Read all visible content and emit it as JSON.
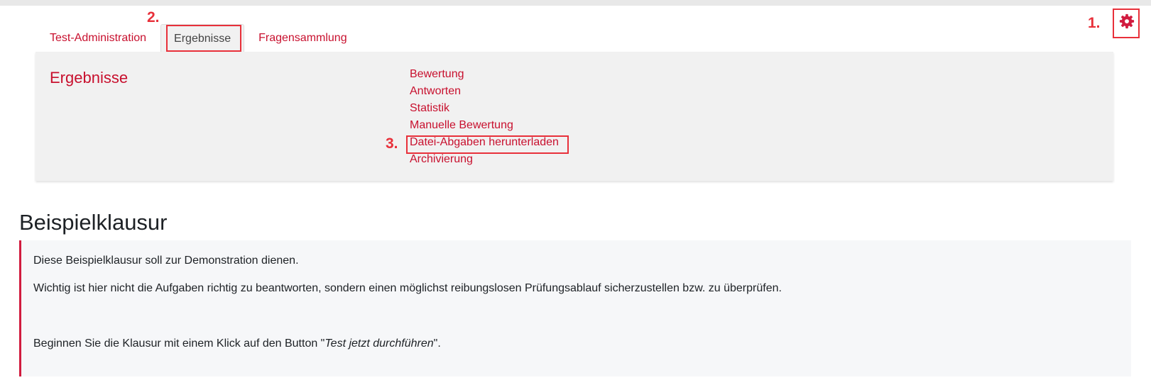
{
  "tabs": [
    {
      "label": "Test-Administration",
      "active": false
    },
    {
      "label": "Ergebnisse",
      "active": true
    },
    {
      "label": "Fragensammlung",
      "active": false
    }
  ],
  "annotations": {
    "step1": "1.",
    "step2": "2.",
    "step3": "3.",
    "color": "#e8303a"
  },
  "panel": {
    "title": "Ergebnisse",
    "links": [
      "Bewertung",
      "Antworten",
      "Statistik",
      "Manuelle Bewertung",
      "Datei-Abgaben herunterladen",
      "Archivierung"
    ]
  },
  "page": {
    "title": "Beispielklausur",
    "intro": "Diese Beispielklausur soll zur Demonstration dienen.",
    "note": "Wichtig ist hier nicht die Aufgaben richtig zu beantworten, sondern einen möglichst reibungslosen Prüfungsablauf sicherzustellen bzw. zu überprüfen.",
    "instruction_prefix": "Beginnen Sie die Klausur mit einem Klick auf den Button \"",
    "instruction_button": "Test jetzt durchführen",
    "instruction_suffix": "\"."
  },
  "icons": {
    "settings": "gear-icon"
  },
  "colors": {
    "brand": "#c8102e",
    "accent_border": "#d11b3f"
  }
}
